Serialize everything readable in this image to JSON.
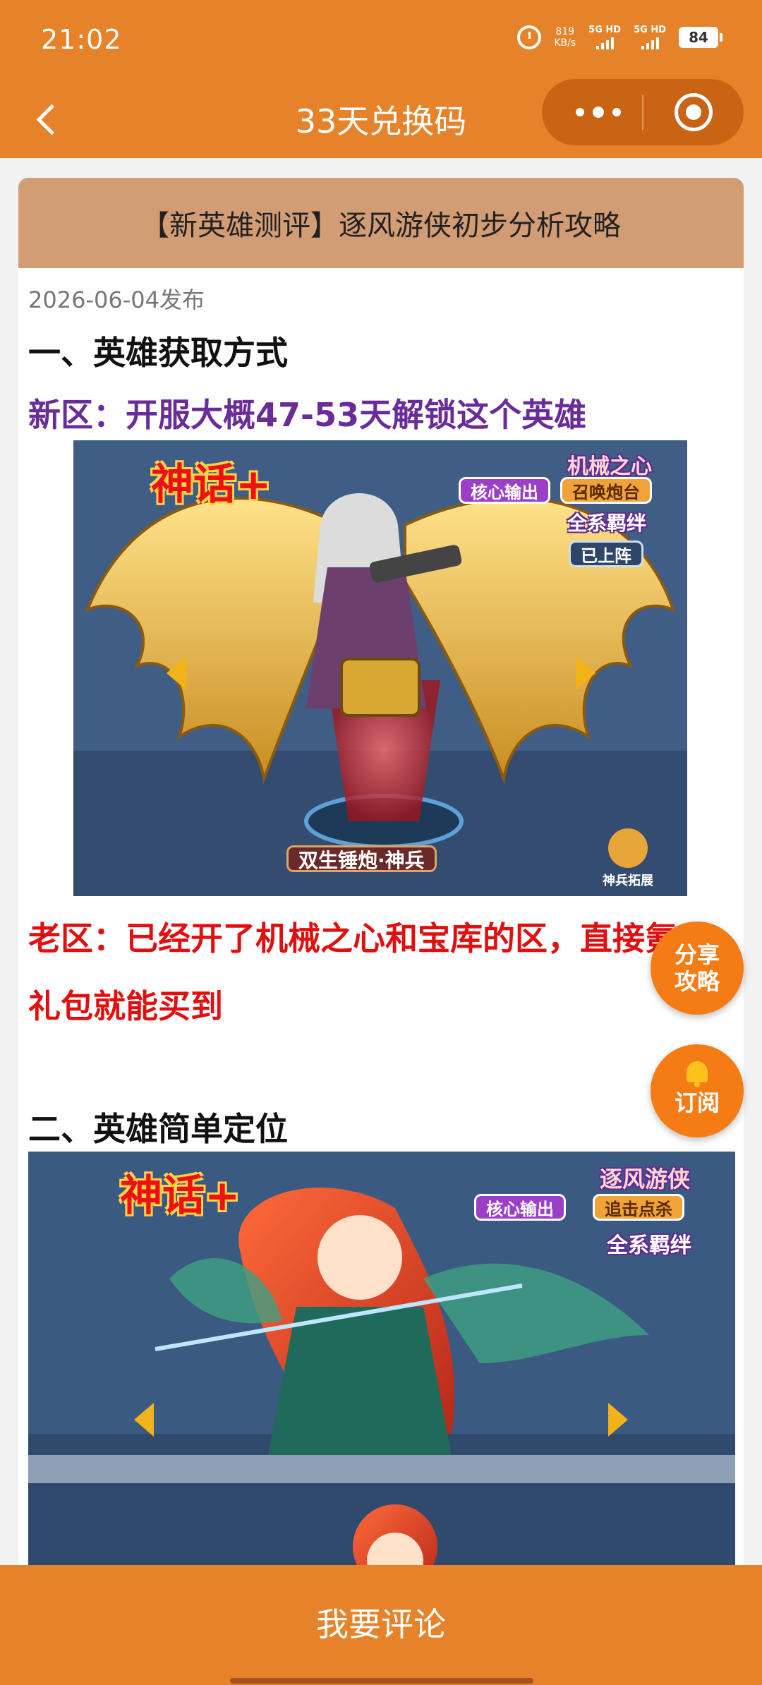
{
  "status": {
    "time": "21:02",
    "speed_value": "819",
    "speed_unit": "KB/s",
    "sim1": "5G HD",
    "sim2": "5G HD",
    "battery": "84"
  },
  "nav": {
    "title": "33天兑换码"
  },
  "article": {
    "header": "【新英雄测评】逐风游侠初步分析攻略",
    "date": "2026-06-04发布",
    "section1_title": "一、英雄获取方式",
    "new_server": "新区：开服大概47-53天解锁这个英雄",
    "old_server": "老区：已经开了机械之心和宝库的区，直接氪金礼包就能买到",
    "section2_title": "二、英雄简单定位"
  },
  "image1": {
    "hero_name": "机械之心",
    "tag1": "核心输出",
    "tag2": "召唤炮台",
    "bond": "全系羁绊",
    "status": "已上阵",
    "weapon": "双生锤炮·神兵",
    "expand": "神兵拓展",
    "myth": "神话+"
  },
  "image2": {
    "hero_name": "逐风游侠",
    "tag1": "核心输出",
    "tag2": "追击点杀",
    "bond": "全系羁绊",
    "myth": "神话+"
  },
  "fab": {
    "share": "分享攻略",
    "share_line1": "分享",
    "share_line2": "攻略",
    "subscribe": "订阅"
  },
  "bottom": {
    "comment": "我要评论"
  },
  "colors": {
    "accent": "#E6822A",
    "header_bg": "#D29C74",
    "purple_text": "#6A2C99",
    "red_text": "#E01010",
    "fab": "#F57B14"
  }
}
